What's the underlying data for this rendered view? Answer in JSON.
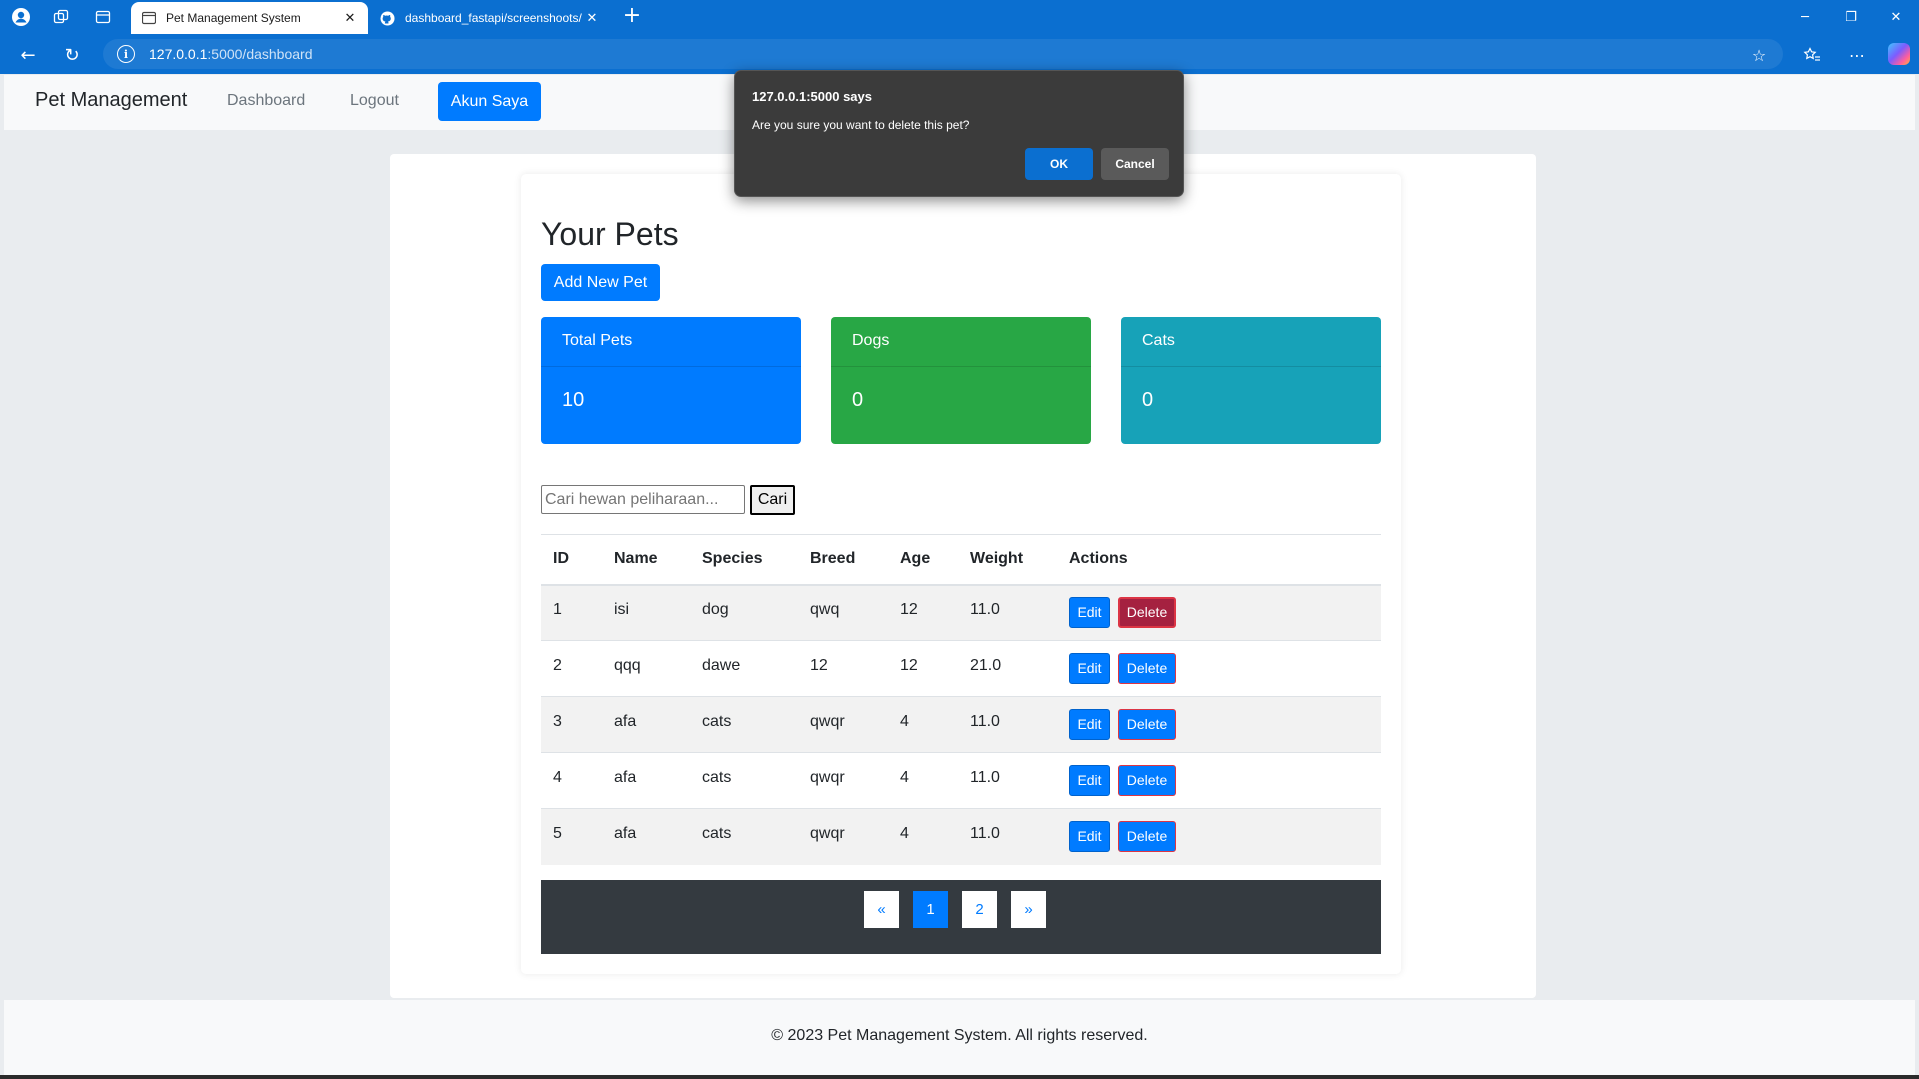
{
  "browser": {
    "tabs": [
      {
        "title": "Pet Management System",
        "active": true
      },
      {
        "title": "dashboard_fastapi/screenshoots/",
        "active": false
      }
    ],
    "url_host": "127.0.0.1",
    "url_rest": ":5000/dashboard"
  },
  "navbar": {
    "brand": "Pet Management",
    "links": [
      "Dashboard",
      "Logout"
    ],
    "active_button": "Akun Saya"
  },
  "main": {
    "title": "Your Pets",
    "add_button": "Add New Pet",
    "cards": [
      {
        "label": "Total Pets",
        "value": "10",
        "color": "#007bff"
      },
      {
        "label": "Dogs",
        "value": "0",
        "color": "#28a745"
      },
      {
        "label": "Cats",
        "value": "0",
        "color": "#17a2b8"
      }
    ],
    "search": {
      "placeholder": "Cari hewan peliharaan...",
      "button": "Cari"
    },
    "table": {
      "headers": [
        "ID",
        "Name",
        "Species",
        "Breed",
        "Age",
        "Weight",
        "Actions"
      ],
      "rows": [
        [
          "1",
          "isi",
          "dog",
          "qwq",
          "12",
          "11.0"
        ],
        [
          "2",
          "qqq",
          "dawe",
          "12",
          "12",
          "21.0"
        ],
        [
          "3",
          "afa",
          "cats",
          "qwqr",
          "4",
          "11.0"
        ],
        [
          "4",
          "afa",
          "cats",
          "qwqr",
          "4",
          "11.0"
        ],
        [
          "5",
          "afa",
          "cats",
          "qwqr",
          "4",
          "11.0"
        ]
      ],
      "edit_label": "Edit",
      "delete_label": "Delete"
    },
    "pagination": {
      "prev": "«",
      "pages": [
        "1",
        "2"
      ],
      "current": "1",
      "next": "»"
    }
  },
  "footer": {
    "text": "© 2023 Pet Management System. All rights reserved."
  },
  "dialog": {
    "title": "127.0.0.1:5000 says",
    "message": "Are you sure you want to delete this pet?",
    "ok": "OK",
    "cancel": "Cancel"
  }
}
